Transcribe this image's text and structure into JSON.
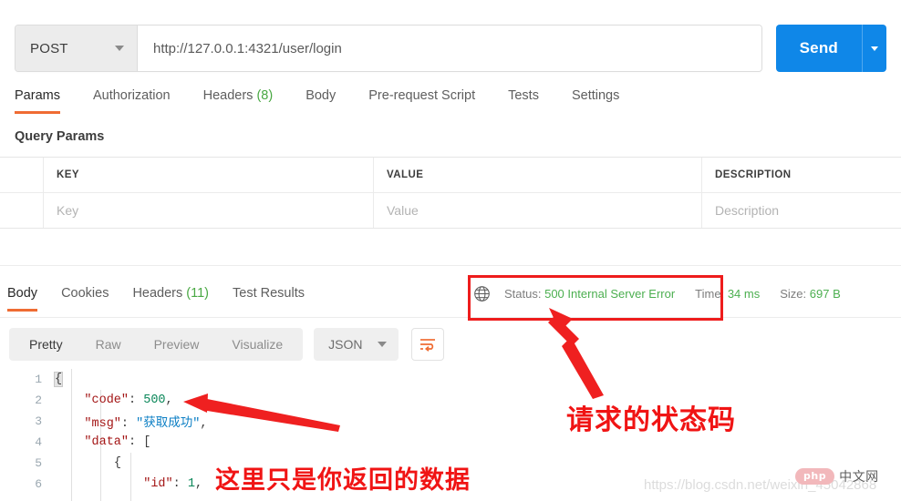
{
  "request": {
    "method": "POST",
    "url": "http://127.0.0.1:4321/user/login",
    "send_label": "Send",
    "tabs": [
      {
        "label": "Params",
        "count": "",
        "active": true
      },
      {
        "label": "Authorization",
        "count": "",
        "active": false
      },
      {
        "label": "Headers",
        "count": "(8)",
        "active": false
      },
      {
        "label": "Body",
        "count": "",
        "active": false
      },
      {
        "label": "Pre-request Script",
        "count": "",
        "active": false
      },
      {
        "label": "Tests",
        "count": "",
        "active": false
      },
      {
        "label": "Settings",
        "count": "",
        "active": false
      }
    ],
    "query_params_label": "Query Params",
    "table": {
      "headers": [
        "KEY",
        "VALUE",
        "DESCRIPTION"
      ],
      "placeholder_row": [
        "Key",
        "Value",
        "Description"
      ]
    }
  },
  "response": {
    "tabs": [
      {
        "label": "Body",
        "count": "",
        "active": true
      },
      {
        "label": "Cookies",
        "count": "",
        "active": false
      },
      {
        "label": "Headers",
        "count": "(11)",
        "active": false
      },
      {
        "label": "Test Results",
        "count": "",
        "active": false
      }
    ],
    "status": {
      "icon": "globe-icon",
      "status_label": "Status:",
      "status_value": "500 Internal Server Error",
      "time_label": "Time:",
      "time_value": "34 ms",
      "size_label": "Size:",
      "size_value": "697 B",
      "value_color": "#4caf50"
    },
    "view_modes": [
      {
        "label": "Pretty",
        "active": true
      },
      {
        "label": "Raw",
        "active": false
      },
      {
        "label": "Preview",
        "active": false
      },
      {
        "label": "Visualize",
        "active": false
      }
    ],
    "format": "JSON",
    "wrap_icon": "word-wrap-icon",
    "code_lines": [
      {
        "num": "1",
        "segments": [
          {
            "t": "{",
            "c": "tok-punc brace-hl"
          }
        ]
      },
      {
        "num": "2",
        "segments": [
          {
            "t": "    ",
            "c": "tok-punc"
          },
          {
            "t": "\"code\"",
            "c": "tok-key"
          },
          {
            "t": ": ",
            "c": "tok-punc"
          },
          {
            "t": "500",
            "c": "tok-num"
          },
          {
            "t": ",",
            "c": "tok-punc"
          }
        ]
      },
      {
        "num": "3",
        "segments": [
          {
            "t": "    ",
            "c": "tok-punc"
          },
          {
            "t": "\"msg\"",
            "c": "tok-key"
          },
          {
            "t": ": ",
            "c": "tok-punc"
          },
          {
            "t": "\"获取成功\"",
            "c": "tok-str"
          },
          {
            "t": ",",
            "c": "tok-punc"
          }
        ]
      },
      {
        "num": "4",
        "segments": [
          {
            "t": "    ",
            "c": "tok-punc"
          },
          {
            "t": "\"data\"",
            "c": "tok-key"
          },
          {
            "t": ": ",
            "c": "tok-punc"
          },
          {
            "t": "[",
            "c": "tok-punc"
          }
        ]
      },
      {
        "num": "5",
        "segments": [
          {
            "t": "        ",
            "c": "tok-punc"
          },
          {
            "t": "{",
            "c": "tok-punc"
          }
        ]
      },
      {
        "num": "6",
        "segments": [
          {
            "t": "            ",
            "c": "tok-punc"
          },
          {
            "t": "\"id\"",
            "c": "tok-key"
          },
          {
            "t": ": ",
            "c": "tok-punc"
          },
          {
            "t": "1",
            "c": "tok-num"
          },
          {
            "t": ",",
            "c": "tok-punc"
          }
        ]
      }
    ]
  },
  "annotations": {
    "status_code_note": "请求的状态码",
    "returned_data_note": "这里只是你返回的数据",
    "box_color": "#ee1c1c",
    "text_color": "#f01414"
  },
  "watermark": {
    "url": "https://blog.csdn.net/weixin_45042868",
    "logo_text": "php",
    "logo_cn": "中文网"
  }
}
